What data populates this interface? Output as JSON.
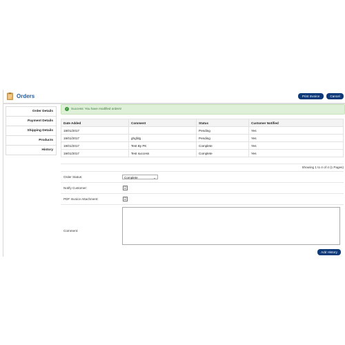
{
  "header": {
    "title": "Orders",
    "print_label": "Print Invoice",
    "cancel_label": "Cancel"
  },
  "tabs": [
    "Order Details",
    "Payment Details",
    "Shipping Details",
    "Products",
    "History"
  ],
  "alert": {
    "message": "Success: You have modified orders!"
  },
  "table": {
    "headers": [
      "Date Added",
      "Comment",
      "Status",
      "Customer Notified"
    ],
    "rows": [
      [
        "19/01/2017",
        "",
        "Pending",
        "Yes"
      ],
      [
        "19/01/2017",
        "ghgfdg",
        "Pending",
        "Yes"
      ],
      [
        "19/01/2017",
        "Test By PK",
        "Complete",
        "Yes"
      ],
      [
        "19/01/2017",
        "Test success",
        "Complete",
        "Yes"
      ]
    ]
  },
  "pagination": {
    "text": "Showing 1 to 4 of 4 (1 Pages)"
  },
  "form": {
    "order_status_label": "Order Status:",
    "order_status_value": "Complete",
    "notify_label": "Notify Customer:",
    "pdf_label": "PDF Invoice Attachment:",
    "comment_label": "Comment:",
    "comment_value": "",
    "checkmark": "☑",
    "add_history_label": "Add History"
  },
  "colors": {
    "accent": "#1f5fa5",
    "button": "#0e3a7a",
    "success_bg": "#dff0d8"
  }
}
